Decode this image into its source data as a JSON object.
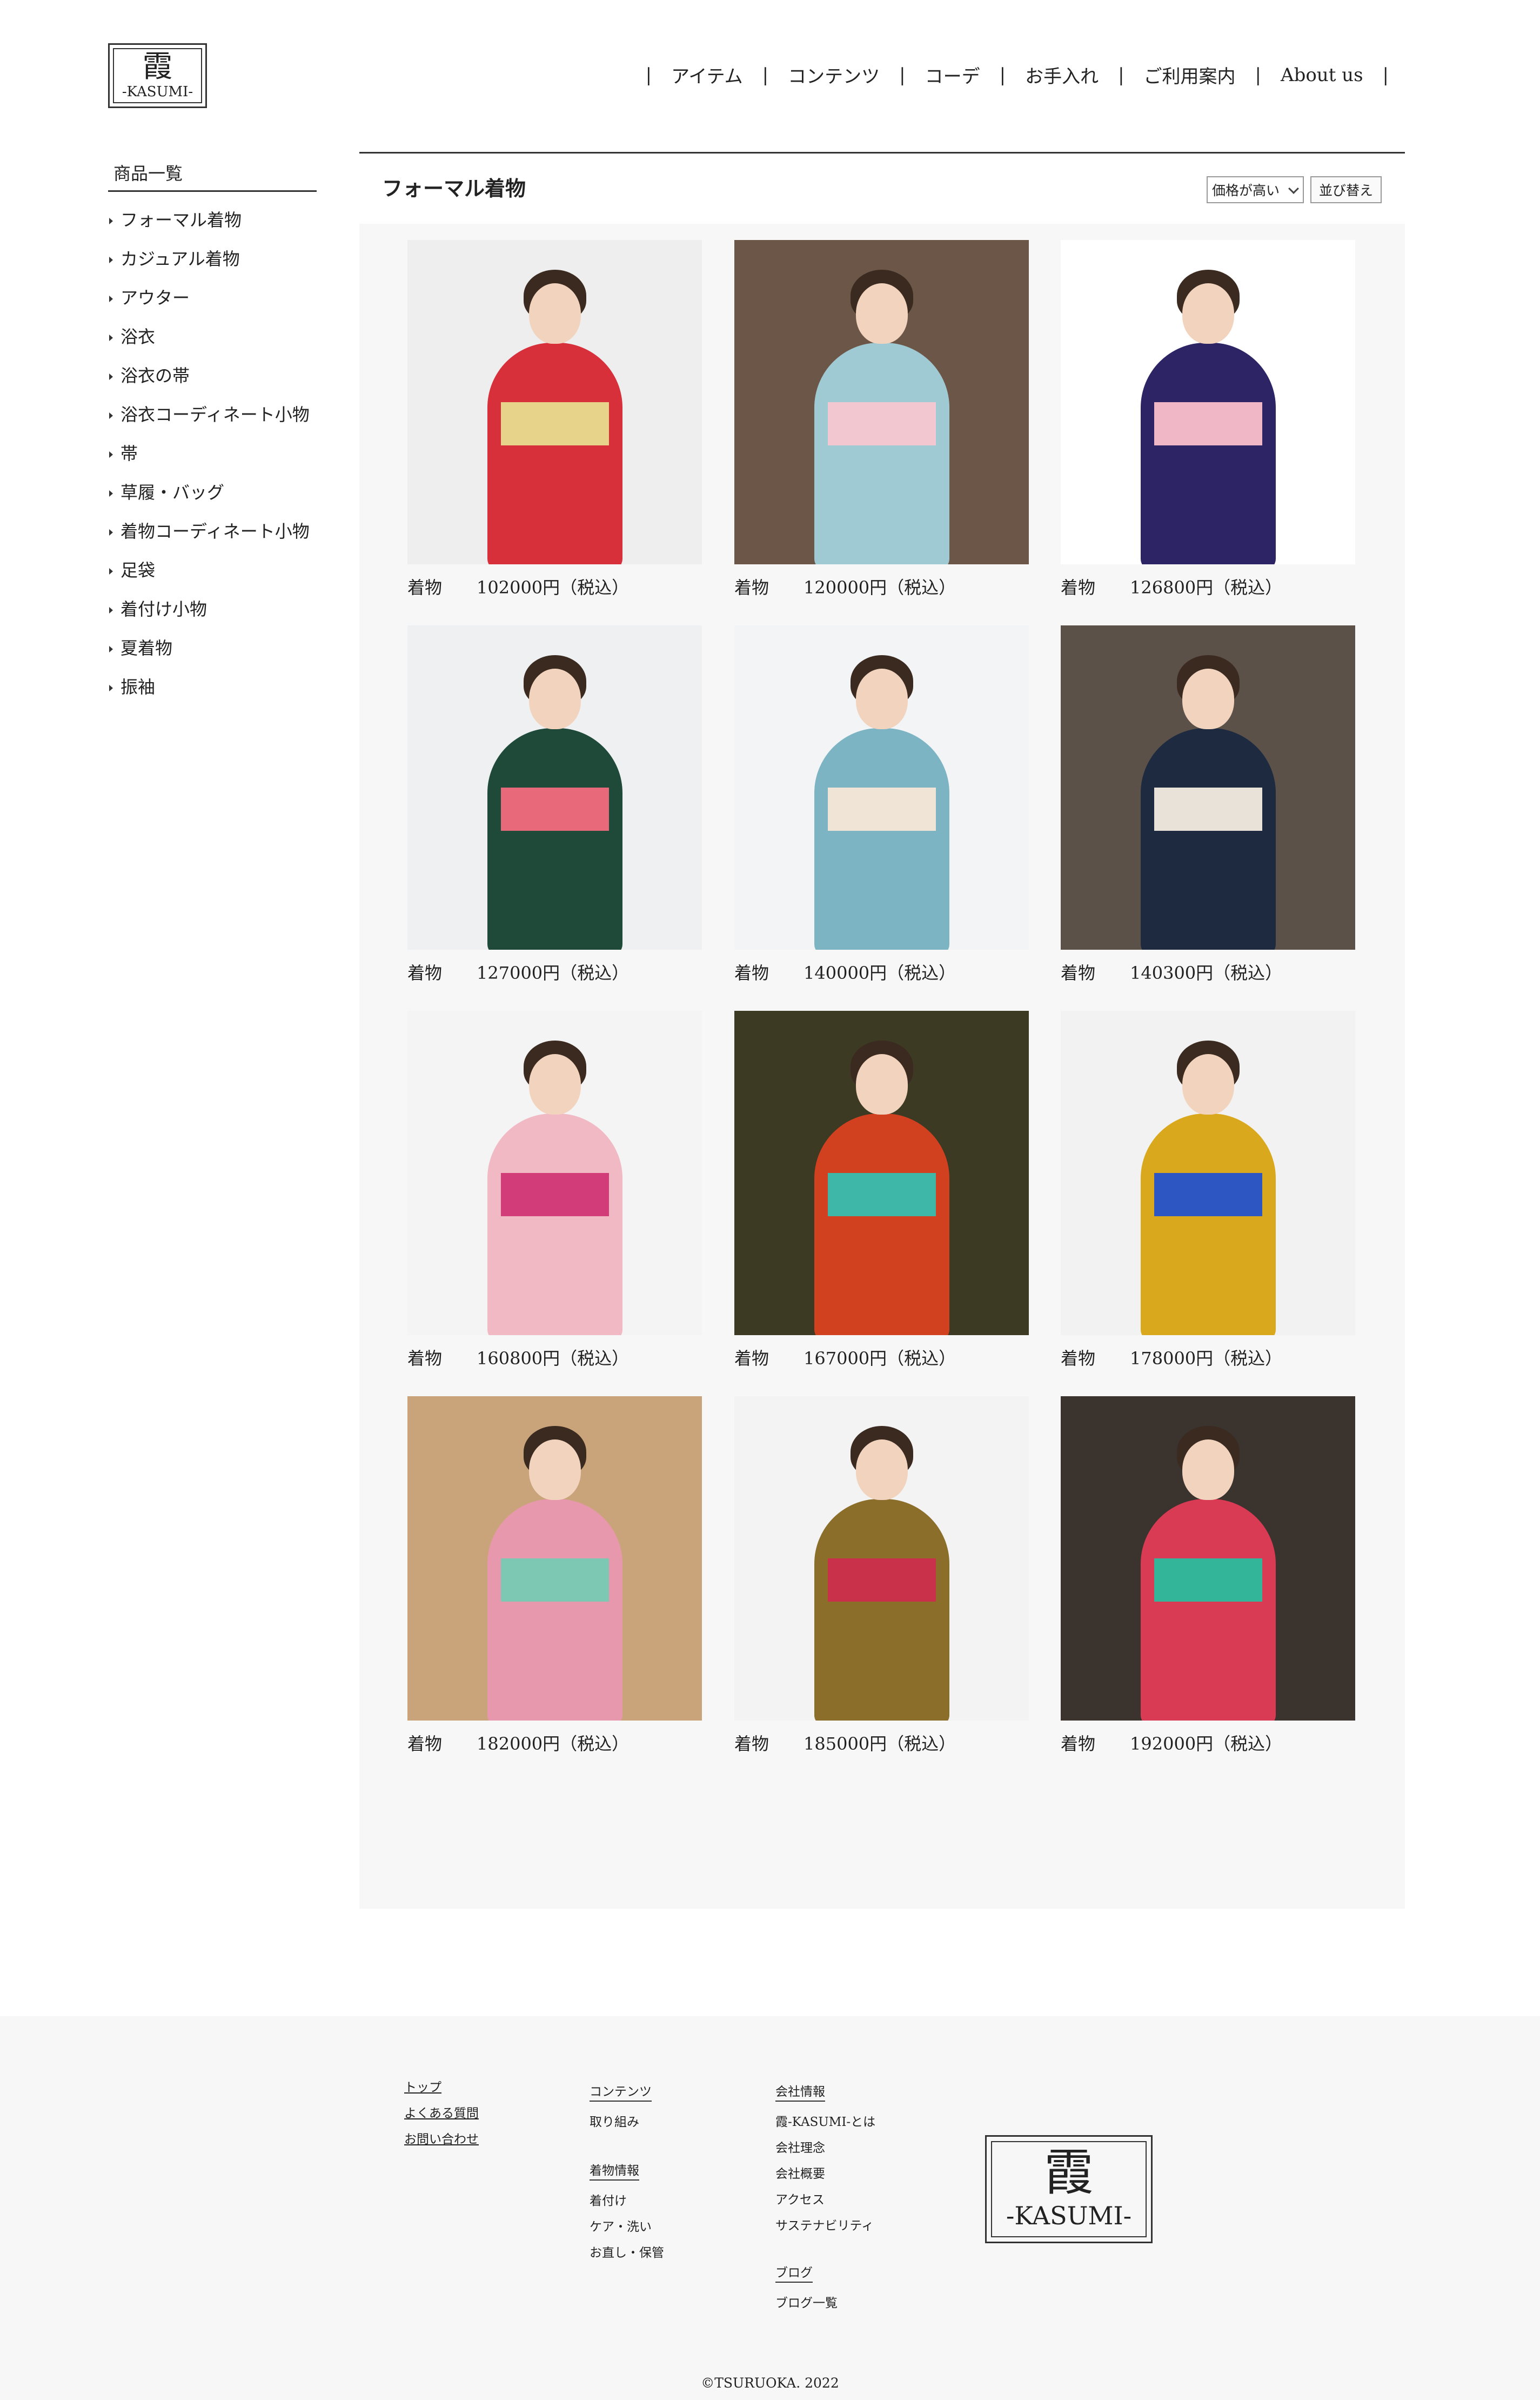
{
  "brand": {
    "kanji": "霞",
    "roman": "-KASUMI-"
  },
  "topnav": {
    "separator": "|",
    "items": [
      "アイテム",
      "コンテンツ",
      "コーデ",
      "お手入れ",
      "ご利用案内",
      "About us"
    ]
  },
  "sidebar": {
    "title": "商品一覧",
    "items": [
      "フォーマル着物",
      "カジュアル着物",
      "アウター",
      "浴衣",
      "浴衣の帯",
      "浴衣コーディネート小物",
      "帯",
      "草履・バッグ",
      "着物コーディネート小物",
      "足袋",
      "着付け小物",
      "夏着物",
      "振袖"
    ]
  },
  "main": {
    "title": "フォーマル着物",
    "sort_selected": "価格が高い",
    "sort_button": "並び替え"
  },
  "products": [
    {
      "category": "着物",
      "price": "102000円（税込）",
      "kimono_color": "#d8303a",
      "obi_color": "#e7d38a",
      "bg_color": "#eeeeee"
    },
    {
      "category": "着物",
      "price": "120000円（税込）",
      "kimono_color": "#9fcad4",
      "obi_color": "#f3c7cf",
      "bg_color": "#6b5647"
    },
    {
      "category": "着物",
      "price": "126800円（税込）",
      "kimono_color": "#2d2466",
      "obi_color": "#f0b7c6",
      "bg_color": "#ffffff"
    },
    {
      "category": "着物",
      "price": "127000円（税込）",
      "kimono_color": "#1f4a3a",
      "obi_color": "#e86a7a",
      "bg_color": "#eef0f2"
    },
    {
      "category": "着物",
      "price": "140000円（税込）",
      "kimono_color": "#7db4c4",
      "obi_color": "#f0e4d6",
      "bg_color": "#f2f4f5"
    },
    {
      "category": "着物",
      "price": "140300円（税込）",
      "kimono_color": "#1d2a40",
      "obi_color": "#e8e2d8",
      "bg_color": "#5c5148"
    },
    {
      "category": "着物",
      "price": "160800円（税込）",
      "kimono_color": "#f1b9c3",
      "obi_color": "#d23c78",
      "bg_color": "#f4f4f4"
    },
    {
      "category": "着物",
      "price": "167000円（税込）",
      "kimono_color": "#d1401f",
      "obi_color": "#3fb7a8",
      "bg_color": "#3c3a22"
    },
    {
      "category": "着物",
      "price": "178000円（税込）",
      "kimono_color": "#d9a81d",
      "obi_color": "#2e56c2",
      "bg_color": "#f2f2f2"
    },
    {
      "category": "着物",
      "price": "182000円（税込）",
      "kimono_color": "#e898ad",
      "obi_color": "#7cc8b2",
      "bg_color": "#c9a47a"
    },
    {
      "category": "着物",
      "price": "185000円（税込）",
      "kimono_color": "#8a6e2a",
      "obi_color": "#c9304a",
      "bg_color": "#f3f3f3"
    },
    {
      "category": "着物",
      "price": "192000円（税込）",
      "kimono_color": "#d93a54",
      "obi_color": "#33b59a",
      "bg_color": "#3a332e"
    }
  ],
  "footer": {
    "col1": [
      "トップ",
      "よくある質問",
      "お問い合わせ"
    ],
    "col2_head": "コンテンツ",
    "col2_items": [
      "取り組み"
    ],
    "col2b_head": "着物情報",
    "col2b_items": [
      "着付け",
      "ケア・洗い",
      "お直し・保管"
    ],
    "col3_head": "会社情報",
    "col3_items": [
      "霞-KASUMI-とは",
      "会社理念",
      "会社概要",
      "アクセス",
      "サステナビリティ"
    ],
    "col3b_head": "ブログ",
    "col3b_items": [
      "ブログ一覧"
    ],
    "copyright": "©TSURUOKA. 2022"
  }
}
